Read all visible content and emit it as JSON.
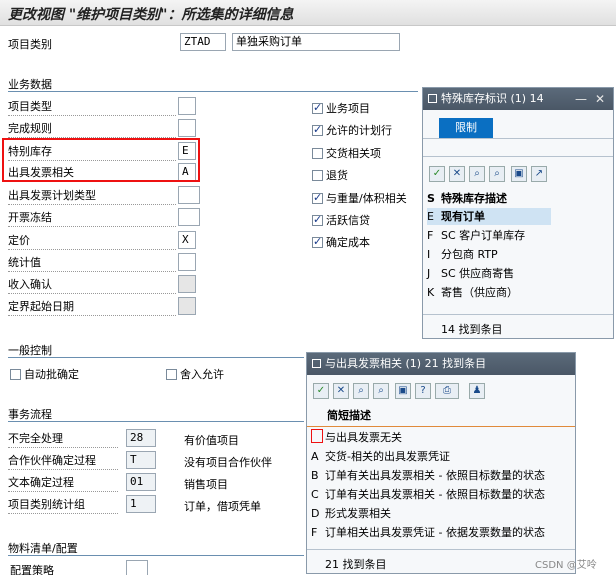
{
  "window": {
    "title": "更改视图 \"维护项目类别\"：所选集的详细信息"
  },
  "header": {
    "item_category_label": "项目类别",
    "item_category_value": "ZTAD",
    "item_category_desc": "单独采购订单"
  },
  "business_data": {
    "section_title": "业务数据",
    "fields": [
      {
        "label": "项目类型",
        "value": ""
      },
      {
        "label": "完成规则",
        "value": ""
      },
      {
        "label": "特别库存",
        "value": "E"
      },
      {
        "label": "出具发票相关",
        "value": "A"
      },
      {
        "label": "出具发票计划类型",
        "value": ""
      },
      {
        "label": "开票冻结",
        "value": ""
      },
      {
        "label": "定价",
        "value": "X"
      },
      {
        "label": "统计值",
        "value": ""
      },
      {
        "label": "收入确认",
        "value": ""
      },
      {
        "label": "定界起始日期",
        "value": ""
      }
    ],
    "checkboxes": [
      {
        "label": "业务项目",
        "checked": true
      },
      {
        "label": "允许的计划行",
        "checked": true
      },
      {
        "label": "交货相关项",
        "checked": false
      },
      {
        "label": "退货",
        "checked": false
      },
      {
        "label": "与重量/体积相关",
        "checked": true
      },
      {
        "label": "活跃信贷",
        "checked": true
      },
      {
        "label": "确定成本",
        "checked": true
      }
    ]
  },
  "general_control": {
    "section_title": "一般控制",
    "auto_batch": "自动批确定",
    "round_allowed": "舍入允许"
  },
  "transaction_flow": {
    "section_title": "事务流程",
    "rows": [
      {
        "label": "不完全处理",
        "value": "28",
        "desc": "有价值项目"
      },
      {
        "label": "合作伙伴确定过程",
        "value": "T",
        "desc": "没有项目合作伙伴"
      },
      {
        "label": "文本确定过程",
        "value": "01",
        "desc": "销售项目"
      },
      {
        "label": "项目类别统计组",
        "value": "1",
        "desc": "订单，借项凭单"
      }
    ]
  },
  "bom": {
    "section_title": "物料清单/配置",
    "config_label": "配置策略"
  },
  "popup_special_stock": {
    "title": "特殊库存标识 (1)  14",
    "tab": "限制",
    "column_key": "S",
    "column_header": "特殊库存描述",
    "rows": [
      {
        "key": "E",
        "text": "现有订单"
      },
      {
        "key": "F",
        "text": "SC 客户订单库存"
      },
      {
        "key": "I",
        "text": "分包商 RTP"
      },
      {
        "key": "J",
        "text": "SC 供应商寄售"
      },
      {
        "key": "K",
        "text": "寄售（供应商）"
      }
    ],
    "status": "14 找到条目"
  },
  "popup_billing": {
    "title": "与出具发票相关 (1)  21 找到条目",
    "column_header": "简短描述",
    "rows": [
      {
        "key": "",
        "text": "与出具发票无关"
      },
      {
        "key": "A",
        "text": "交货-相关的出具发票凭证"
      },
      {
        "key": "B",
        "text": "订单有关出具发票相关 - 依照目标数量的状态"
      },
      {
        "key": "C",
        "text": "订单有关出具发票相关 - 依照目标数量的状态"
      },
      {
        "key": "D",
        "text": "形式发票相关"
      },
      {
        "key": "F",
        "text": "订单相关出具发票凭证 - 依据发票数量的状态"
      }
    ],
    "status": "21 找到条目"
  },
  "watermark": "CSDN @艾呤"
}
